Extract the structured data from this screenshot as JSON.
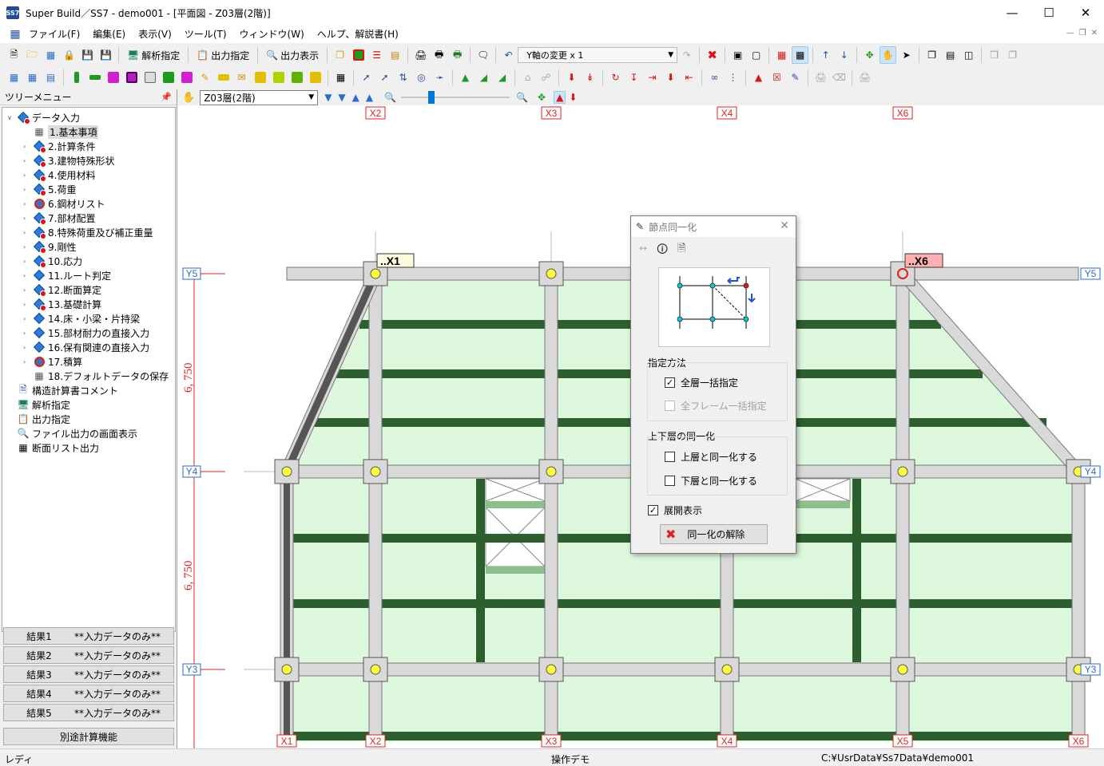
{
  "window": {
    "title": "Super Build／SS7 - demo001 - [平面図 - Z03層(2階)]",
    "app_icon_text": "SS7"
  },
  "menu": [
    "ファイル(F)",
    "編集(E)",
    "表示(V)",
    "ツール(T)",
    "ウィンドウ(W)",
    "ヘルプ、解説書(H)"
  ],
  "toolbar1": {
    "analysis": "解析指定",
    "output_spec": "出力指定",
    "output_view": "出力表示",
    "y_axis": "Y軸の変更 x 1"
  },
  "tree": {
    "header": "ツリーメニュー",
    "root": "データ入力",
    "items": [
      "1.基本事項",
      "2.計算条件",
      "3.建物特殊形状",
      "4.使用材料",
      "5.荷重",
      "6.鋼材リスト",
      "7.部材配置",
      "8.特殊荷重及び補正重量",
      "9.剛性",
      "10.応力",
      "11.ルート判定",
      "12.断面算定",
      "13.基礎計算",
      "14.床・小梁・片持梁",
      "15.部材耐力の直接入力",
      "16.保有関連の直接入力",
      "17.積算",
      "18.デフォルトデータの保存"
    ],
    "top_items": [
      "構造計算書コメント",
      "解析指定",
      "出力指定",
      "ファイル出力の画面表示",
      "断面リスト出力"
    ]
  },
  "results": [
    {
      "label": "結果1",
      "value": "**入力データのみ**"
    },
    {
      "label": "結果2",
      "value": "**入力データのみ**"
    },
    {
      "label": "結果3",
      "value": "**入力データのみ**"
    },
    {
      "label": "結果4",
      "value": "**入力データのみ**"
    },
    {
      "label": "結果5",
      "value": "**入力データのみ**"
    }
  ],
  "separate_calc": "別途計算機能",
  "floor": "Z03層(2階)",
  "grid": {
    "x_top": [
      "X2",
      "X3",
      "X4",
      "X6"
    ],
    "x_bottom": [
      "X1",
      "X2",
      "X3",
      "X4",
      "X5",
      "X6"
    ],
    "y": [
      "Y5",
      "Y4",
      "Y3"
    ],
    "spans": [
      "6, 750",
      "6, 750"
    ],
    "tag_x1": "..X1",
    "tag_x6": "..X6"
  },
  "dialog": {
    "title": "節点同一化",
    "group1": "指定方法",
    "opt_all_floor": "全層一括指定",
    "opt_all_frame": "全フレーム一括指定",
    "group2": "上下層の同一化",
    "opt_upper": "上層と同一化する",
    "opt_lower": "下層と同一化する",
    "opt_expand": "展開表示",
    "release": "同一化の解除"
  },
  "status": {
    "left": "レディ",
    "center": "操作デモ",
    "right": "C:¥UsrData¥Ss7Data¥demo001"
  },
  "colors": {
    "slab": "#ddf8dd",
    "beam": "#d9d9d9",
    "joist": "#2d5e2d",
    "axis_red": "#e02020"
  }
}
